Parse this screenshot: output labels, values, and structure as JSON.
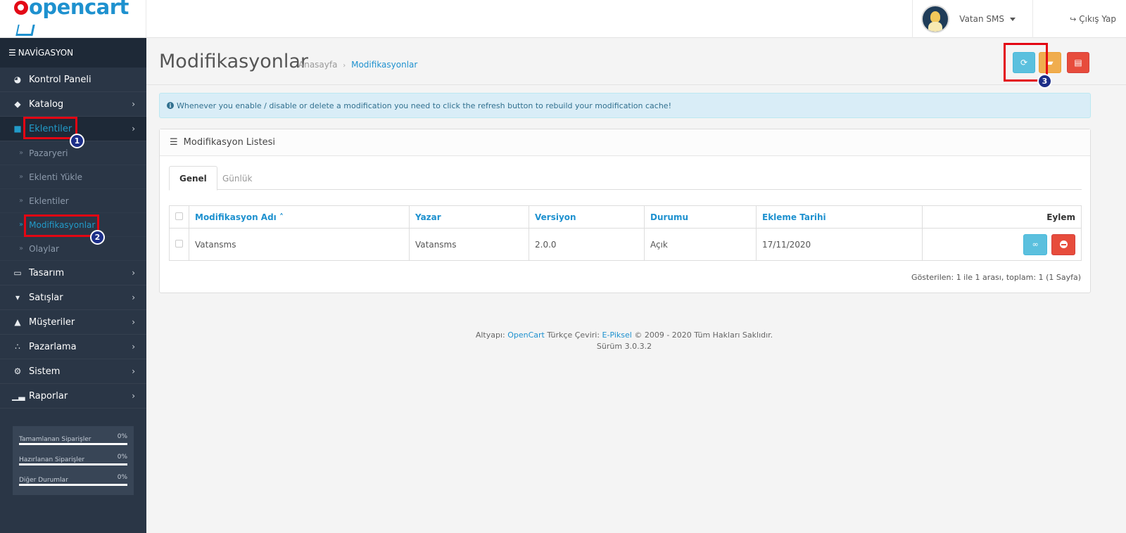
{
  "header": {
    "logo": "opencart",
    "user_name": "Vatan SMS",
    "logout_label": "Çıkış Yap"
  },
  "sidebar": {
    "heading": "NAVİGASYON",
    "items": [
      {
        "label": "Kontrol Paneli",
        "icon": "dashboard-icon"
      },
      {
        "label": "Katalog",
        "icon": "tags-icon"
      },
      {
        "label": "Eklentiler",
        "icon": "puzzle-icon",
        "active": true
      },
      {
        "label": "Tasarım",
        "icon": "monitor-icon"
      },
      {
        "label": "Satışlar",
        "icon": "cart-icon"
      },
      {
        "label": "Müşteriler",
        "icon": "user-icon"
      },
      {
        "label": "Pazarlama",
        "icon": "share-icon"
      },
      {
        "label": "Sistem",
        "icon": "gear-icon"
      },
      {
        "label": "Raporlar",
        "icon": "bar-chart-icon"
      }
    ],
    "subitems": [
      {
        "label": "Pazaryeri"
      },
      {
        "label": "Eklenti Yükle"
      },
      {
        "label": "Eklentiler"
      },
      {
        "label": "Modifikasyonlar",
        "active": true
      },
      {
        "label": "Olaylar"
      }
    ],
    "progress": [
      {
        "label": "Tamamlanan Siparişler",
        "percent": "0%",
        "value": 0
      },
      {
        "label": "Hazırlanan Siparişler",
        "percent": "0%",
        "value": 0
      },
      {
        "label": "Diğer Durumlar",
        "percent": "0%",
        "value": 0
      }
    ]
  },
  "annotations": {
    "badge1": "1",
    "badge2": "2",
    "badge3": "3"
  },
  "page": {
    "title": "Modifikasyonlar",
    "breadcrumb_home": "Anasayfa",
    "breadcrumb_current": "Modifikasyonlar",
    "alert": "Whenever you enable / disable or delete a modification you need to click the refresh button to rebuild your modification cache!",
    "panel_title": "Modifikasyon Listesi",
    "tabs": [
      "Genel",
      "Günlük"
    ],
    "table": {
      "columns": [
        "Modifikasyon Adı",
        "Yazar",
        "Versiyon",
        "Durumu",
        "Ekleme Tarihi",
        "Eylem"
      ],
      "rows": [
        {
          "name": "Vatansms",
          "author": "Vatansms",
          "version": "2.0.0",
          "status": "Açık",
          "date": "17/11/2020"
        }
      ]
    },
    "results": "Gösterilen: 1 ile 1 arası, toplam: 1 (1 Sayfa)"
  },
  "footer": {
    "prefix": "Altyapı:",
    "opencart_link": "OpenCart",
    "translation": "Türkçe Çeviri:",
    "epiksel_link": "E-Piksel",
    "rights": "© 2009 - 2020 Tüm Hakları Saklıdır.",
    "version": "Sürüm 3.0.3.2"
  },
  "colors": {
    "accent": "#1e91cf",
    "sidebar": "#2a3646",
    "refresh": "#5bc0de",
    "clear": "#f0ad4e",
    "delete": "#e74c3c",
    "marker": "#e30613",
    "badge": "#1c2e88"
  }
}
